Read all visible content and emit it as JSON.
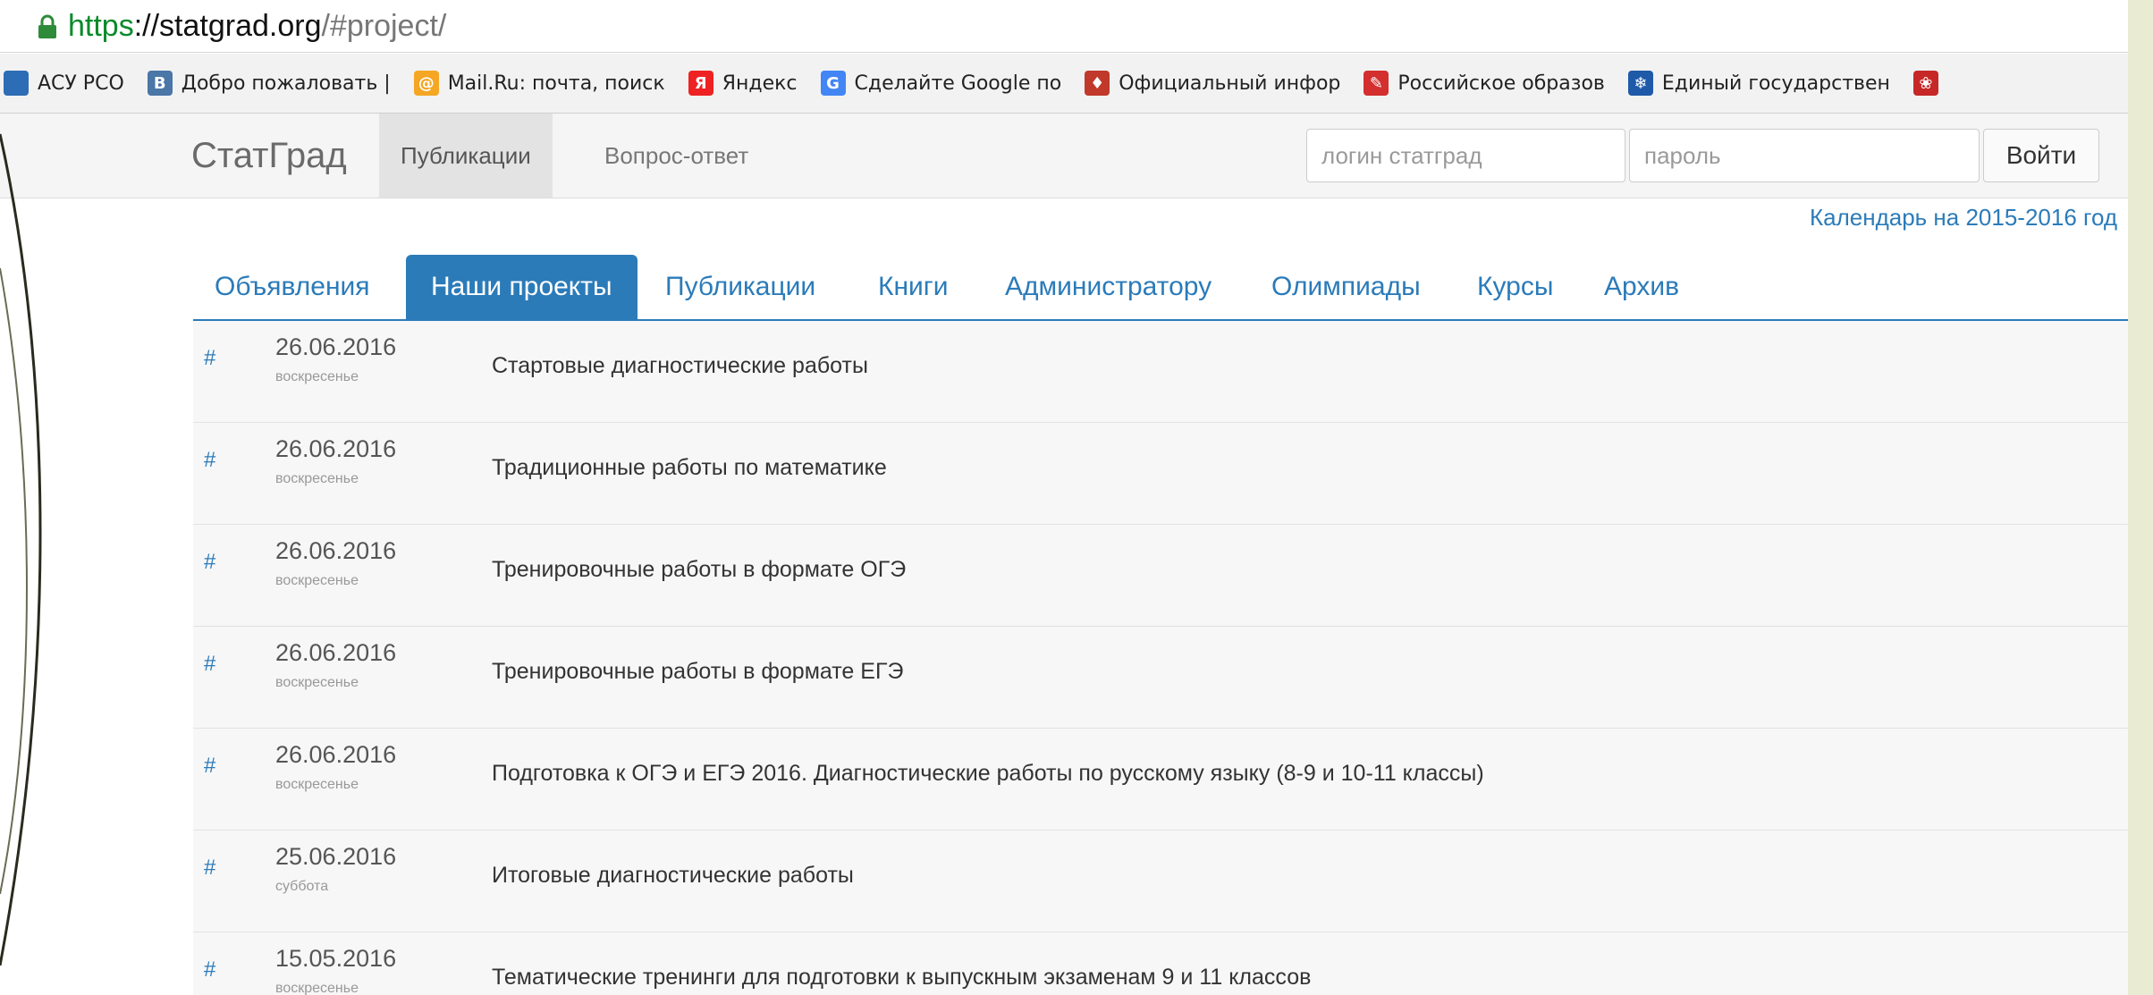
{
  "browser": {
    "url_scheme": "https",
    "url_host": "://statgrad.org",
    "url_path": "/#project/",
    "bookmarks": [
      {
        "label": "АСУ РСО",
        "icon": "flag-icon",
        "color": "#2d6db5"
      },
      {
        "label": "Добро пожаловать |",
        "icon": "vk-icon",
        "color": "#4a76a8",
        "glyph": "В"
      },
      {
        "label": "Mail.Ru: почта, поиск",
        "icon": "mailru-icon",
        "color": "#f5a623",
        "glyph": "@"
      },
      {
        "label": "Яндекс",
        "icon": "yandex-icon",
        "color": "#e22",
        "glyph": "Я"
      },
      {
        "label": "Сделайте Google по",
        "icon": "google-icon",
        "color": "#4285f4",
        "glyph": "G"
      },
      {
        "label": "Официальный инфор",
        "icon": "eagle-icon",
        "color": "#c0392b",
        "glyph": "♦"
      },
      {
        "label": "Российское образов",
        "icon": "feather-icon",
        "color": "#d32f2f",
        "glyph": "✎"
      },
      {
        "label": "Единый государствен",
        "icon": "gosuslugi-icon",
        "color": "#1e5aa8",
        "glyph": "❄"
      },
      {
        "label": "",
        "icon": "tea-icon",
        "color": "#c62828",
        "glyph": "❀"
      }
    ]
  },
  "navbar": {
    "brand": "СтатГрад",
    "items": [
      {
        "label": "Публикации",
        "active": true
      },
      {
        "label": "Вопрос-ответ",
        "active": false
      }
    ],
    "login_placeholder": "логин статград",
    "password_placeholder": "пароль",
    "login_button": "Войти"
  },
  "calendar_link": "Календарь на 2015-2016 год",
  "tabs": [
    {
      "label": "Объявления",
      "active": false
    },
    {
      "label": "Наши проекты",
      "active": true
    },
    {
      "label": "Публикации",
      "active": false
    },
    {
      "label": "Книги",
      "active": false
    },
    {
      "label": "Администратору",
      "active": false
    },
    {
      "label": "Олимпиады",
      "active": false
    },
    {
      "label": "Курсы",
      "active": false
    },
    {
      "label": "Архив",
      "active": false
    }
  ],
  "items": [
    {
      "hash": "#",
      "date": "26.06.2016",
      "weekday": "воскресенье",
      "title": "Стартовые диагностические работы"
    },
    {
      "hash": "#",
      "date": "26.06.2016",
      "weekday": "воскресенье",
      "title": "Традиционные работы по математике"
    },
    {
      "hash": "#",
      "date": "26.06.2016",
      "weekday": "воскресенье",
      "title": "Тренировочные работы в формате ОГЭ"
    },
    {
      "hash": "#",
      "date": "26.06.2016",
      "weekday": "воскресенье",
      "title": "Тренировочные работы в формате ЕГЭ"
    },
    {
      "hash": "#",
      "date": "26.06.2016",
      "weekday": "воскресенье",
      "title": "Подготовка к ОГЭ и ЕГЭ 2016. Диагностические работы по русскому языку (8-9 и 10-11 классы)"
    },
    {
      "hash": "#",
      "date": "25.06.2016",
      "weekday": "суббота",
      "title": "Итоговые диагностические работы"
    },
    {
      "hash": "#",
      "date": "15.05.2016",
      "weekday": "воскресенье",
      "title": "Тематические тренинги для подготовки к выпускным экзаменам 9 и 11 классов"
    }
  ]
}
